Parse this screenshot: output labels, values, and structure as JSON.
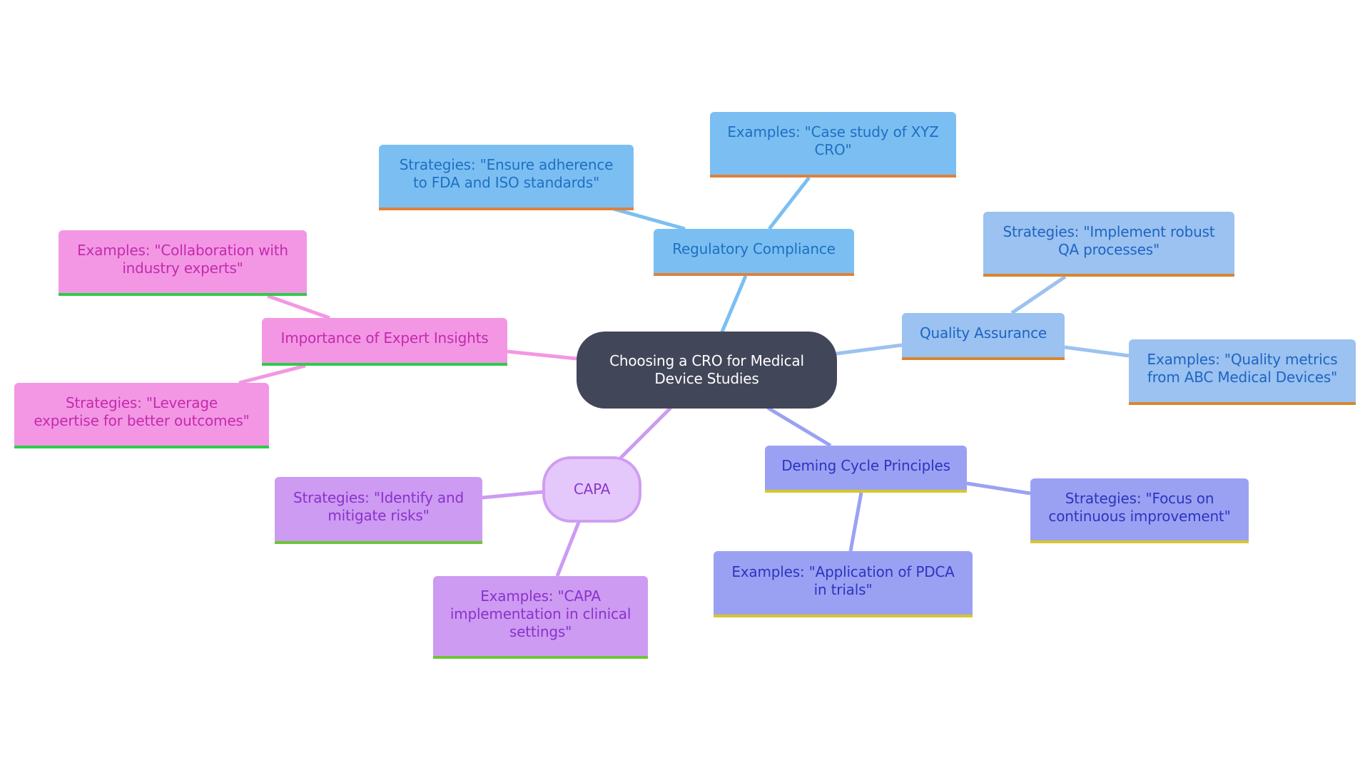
{
  "diagram": {
    "type": "mindmap",
    "root": {
      "id": "root",
      "label": "Choosing a CRO for Medical Device Studies"
    },
    "colors": {
      "root_fill": "#424659",
      "regulatory": "#7bbff2",
      "quality": "#9bc2f0",
      "deming": "#9ba1f2",
      "capa": "#cd9bf2",
      "expert": "#f397e4"
    },
    "nodes": [
      {
        "id": "reg",
        "label": "Regulatory Compliance",
        "parent": "root"
      },
      {
        "id": "reg-str",
        "label": "Strategies: \"Ensure adherence to FDA and ISO standards\"",
        "parent": "reg"
      },
      {
        "id": "reg-ex",
        "label": "Examples: \"Case study of XYZ CRO\"",
        "parent": "reg"
      },
      {
        "id": "qa",
        "label": "Quality Assurance",
        "parent": "root"
      },
      {
        "id": "qa-str",
        "label": "Strategies: \"Implement robust QA processes\"",
        "parent": "qa"
      },
      {
        "id": "qa-ex",
        "label": "Examples: \"Quality metrics from ABC Medical Devices\"",
        "parent": "qa"
      },
      {
        "id": "dem",
        "label": "Deming Cycle Principles",
        "parent": "root"
      },
      {
        "id": "dem-str",
        "label": "Strategies: \"Focus on continuous improvement\"",
        "parent": "dem"
      },
      {
        "id": "dem-ex",
        "label": "Examples: \"Application of PDCA in trials\"",
        "parent": "dem"
      },
      {
        "id": "capa",
        "label": "CAPA",
        "parent": "root"
      },
      {
        "id": "capa-str",
        "label": "Strategies: \"Identify and mitigate risks\"",
        "parent": "capa"
      },
      {
        "id": "capa-ex",
        "label": "Examples: \"CAPA implementation in clinical settings\"",
        "parent": "capa"
      },
      {
        "id": "exp",
        "label": "Importance of Expert Insights",
        "parent": "root"
      },
      {
        "id": "exp-ex",
        "label": "Examples: \"Collaboration with industry experts\"",
        "parent": "exp"
      },
      {
        "id": "exp-str",
        "label": "Strategies: \"Leverage expertise for better outcomes\"",
        "parent": "exp"
      }
    ]
  },
  "text": {
    "root_l1": "Choosing a CRO for Medical",
    "root_l2": "Device Studies",
    "reg": "Regulatory Compliance",
    "reg_str_l1": "Strategies: \"Ensure adherence",
    "reg_str_l2": "to FDA and ISO standards\"",
    "reg_ex_l1": "Examples: \"Case study of XYZ",
    "reg_ex_l2": "CRO\"",
    "qa": "Quality Assurance",
    "qa_str_l1": "Strategies: \"Implement robust",
    "qa_str_l2": "QA processes\"",
    "qa_ex_l1": "Examples: \"Quality metrics",
    "qa_ex_l2": "from ABC Medical Devices\"",
    "dem": "Deming Cycle Principles",
    "dem_str_l1": "Strategies: \"Focus on",
    "dem_str_l2": "continuous improvement\"",
    "dem_ex_l1": "Examples: \"Application of PDCA",
    "dem_ex_l2": "in trials\"",
    "capa": "CAPA",
    "capa_str_l1": "Strategies: \"Identify and",
    "capa_str_l2": "mitigate risks\"",
    "capa_ex_l1": "Examples: \"CAPA",
    "capa_ex_l2": "implementation in clinical",
    "capa_ex_l3": "settings\"",
    "exp": "Importance of Expert Insights",
    "exp_ex_l1": "Examples: \"Collaboration with",
    "exp_ex_l2": "industry experts\"",
    "exp_str_l1": "Strategies: \"Leverage",
    "exp_str_l2": "expertise for better outcomes\""
  }
}
